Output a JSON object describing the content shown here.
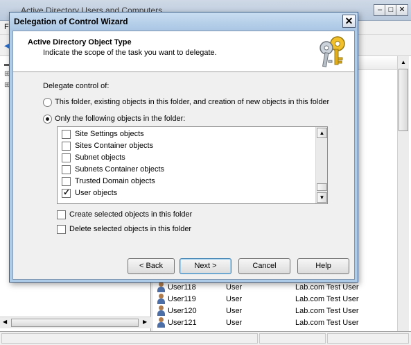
{
  "background_window": {
    "title": "Active Directory Users and Computers",
    "menu_initial": "F",
    "users": [
      {
        "name": "User118",
        "type": "User",
        "description": "Lab.com Test User"
      },
      {
        "name": "User119",
        "type": "User",
        "description": "Lab.com Test User"
      },
      {
        "name": "User120",
        "type": "User",
        "description": "Lab.com Test User"
      },
      {
        "name": "User121",
        "type": "User",
        "description": "Lab.com Test User"
      }
    ]
  },
  "dialog": {
    "title": "Delegation of Control Wizard",
    "close_label": "✕",
    "header": {
      "title": "Active Directory Object Type",
      "subtitle": "Indicate the scope of the task you want to delegate.",
      "icon": "keys-icon"
    },
    "delegate_label": "Delegate control of:",
    "radio_options": [
      {
        "label": "This folder, existing objects in this folder, and creation of new objects in this folder",
        "selected": false
      },
      {
        "label": "Only the following objects in the folder:",
        "selected": true
      }
    ],
    "object_list": [
      {
        "label": "Site Settings objects",
        "checked": false
      },
      {
        "label": "Sites Container objects",
        "checked": false
      },
      {
        "label": "Subnet objects",
        "checked": false
      },
      {
        "label": "Subnets Container objects",
        "checked": false
      },
      {
        "label": "Trusted Domain objects",
        "checked": false
      },
      {
        "label": "User objects",
        "checked": true
      }
    ],
    "create_selected_label": "Create selected objects in this folder",
    "delete_selected_label": "Delete selected objects in this folder",
    "buttons": {
      "back": "< Back",
      "next": "Next >",
      "cancel": "Cancel",
      "help": "Help"
    }
  },
  "colors": {
    "dialog_frame": "#aecbe7",
    "dialog_body": "#f0f0f0",
    "default_button_border": "#3c7fb1"
  }
}
